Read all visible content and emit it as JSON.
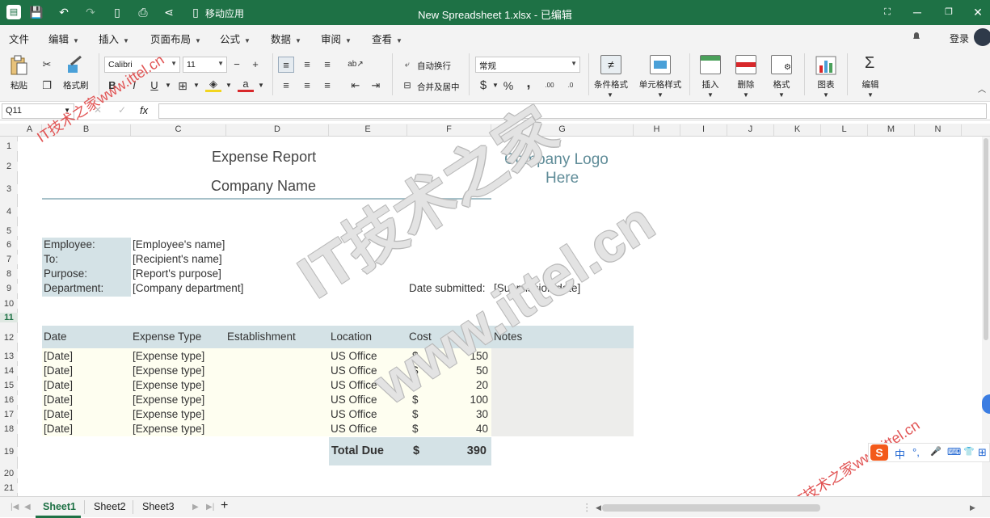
{
  "window": {
    "title": "New Spreadsheet 1.xlsx - 已编辑",
    "mobile_app_label": "移动应用",
    "app_logo": "spreadsheet-icon"
  },
  "menubar": {
    "items": [
      {
        "label": "文件",
        "caret": false
      },
      {
        "label": "编辑",
        "caret": true
      },
      {
        "label": "插入",
        "caret": true
      },
      {
        "label": "页面布局",
        "caret": true
      },
      {
        "label": "公式",
        "caret": true
      },
      {
        "label": "数据",
        "caret": true
      },
      {
        "label": "审阅",
        "caret": true
      },
      {
        "label": "查看",
        "caret": true
      }
    ],
    "login_label": "登录"
  },
  "ribbon": {
    "paste_label": "粘贴",
    "format_painter_label": "格式刷",
    "font_name": "Calibri",
    "font_size": "11",
    "bold": "B",
    "italic": "I",
    "underline": "U",
    "font_color_glyph": "a",
    "wrap_text_label": "自动换行",
    "merge_center_label": "合并及居中",
    "number_format": "常规",
    "currency_glyph": "$",
    "percent_glyph": "%",
    "comma_glyph": ",",
    "inc_decimal": ".00",
    "dec_decimal": ".0",
    "conditional_format_label": "条件格式",
    "cell_style_label": "单元格样式",
    "insert_label": "插入",
    "delete_label": "删除",
    "format_label": "格式",
    "chart_label": "图表",
    "edit_label": "编辑",
    "accent_color": "#1e7145"
  },
  "formulabar": {
    "name_box": "Q11",
    "fx": "fx",
    "cancel_glyph": "✕",
    "confirm_glyph": "✓"
  },
  "columns": [
    "A",
    "B",
    "C",
    "D",
    "E",
    "F",
    "G",
    "H",
    "I",
    "J",
    "K",
    "L",
    "M",
    "N"
  ],
  "rows": [
    "1",
    "2",
    "3",
    "4",
    "5",
    "6",
    "7",
    "8",
    "9",
    "10",
    "11",
    "12",
    "13",
    "14",
    "15",
    "16",
    "17",
    "18",
    "19",
    "20",
    "21"
  ],
  "sheet": {
    "title": "Expense Report",
    "company_name": "Company Name",
    "company_logo": "Company Logo",
    "company_logo_2": "Here",
    "info_labels": [
      "Employee:",
      "To:",
      "Purpose:",
      "Department:"
    ],
    "info_values": [
      "[Employee's name]",
      "[Recipient's name]",
      "[Report's purpose]",
      "[Company department]"
    ],
    "date_submitted_label": "Date submitted:",
    "date_submitted_value": "[Submission date]",
    "table_headers": [
      "Date",
      "Expense Type",
      "Establishment",
      "Location",
      "Cost",
      "Notes"
    ],
    "rows": [
      {
        "date": "[Date]",
        "type": "[Expense type]",
        "location": "US Office",
        "currency": "$",
        "cost": "150"
      },
      {
        "date": "[Date]",
        "type": "[Expense type]",
        "location": "US Office",
        "currency": "$",
        "cost": "50"
      },
      {
        "date": "[Date]",
        "type": "[Expense type]",
        "location": "US Office",
        "currency": "$",
        "cost": "20"
      },
      {
        "date": "[Date]",
        "type": "[Expense type]",
        "location": "US Office",
        "currency": "$",
        "cost": "100"
      },
      {
        "date": "[Date]",
        "type": "[Expense type]",
        "location": "US Office",
        "currency": "$",
        "cost": "30"
      },
      {
        "date": "[Date]",
        "type": "[Expense type]",
        "location": "US Office",
        "currency": "$",
        "cost": "40"
      }
    ],
    "total_label": "Total Due",
    "total_currency": "$",
    "total_value": "390",
    "header_fill": "#d4e2e6"
  },
  "tabs": {
    "sheets": [
      "Sheet1",
      "Sheet2",
      "Sheet3"
    ],
    "active": "Sheet1",
    "add_glyph": "+"
  },
  "watermark": {
    "big_1": "IT技术之家",
    "big_2": "www.ittel.cn",
    "corner_top": "IT技术之家www.ittel.cn",
    "corner_bottom": "IT技术之家www.ittel.cn"
  },
  "ime": {
    "logo": "S",
    "items": [
      "中",
      "°,",
      "🎤",
      "⌨",
      "👕",
      "⊞"
    ]
  }
}
